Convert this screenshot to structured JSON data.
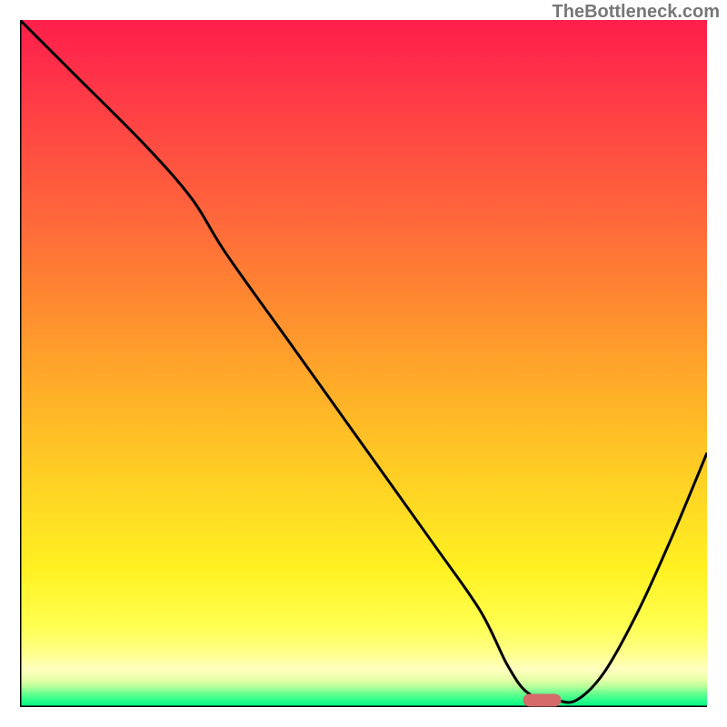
{
  "watermark": "TheBottleneck.com",
  "chart_data": {
    "type": "line",
    "title": "",
    "xlabel": "",
    "ylabel": "",
    "xlim": [
      0,
      100
    ],
    "ylim": [
      0,
      100
    ],
    "grid": false,
    "legend": false,
    "background_gradient": {
      "top": "#ff1f4b",
      "middle": "#ffd823",
      "bottom": "#00ef82"
    },
    "series": [
      {
        "name": "bottleneck-curve",
        "x": [
          0,
          8,
          18,
          25,
          30,
          40,
          50,
          60,
          67,
          71,
          74,
          78,
          81,
          85,
          90,
          95,
          100
        ],
        "values": [
          100,
          92,
          82,
          74,
          66,
          52,
          38,
          24,
          14,
          6,
          2,
          1,
          1,
          5,
          14,
          25,
          37
        ]
      }
    ],
    "marker": {
      "x": 76,
      "y": 1,
      "color": "#d46a6a",
      "shape": "pill"
    },
    "axes_color": "#000000"
  }
}
